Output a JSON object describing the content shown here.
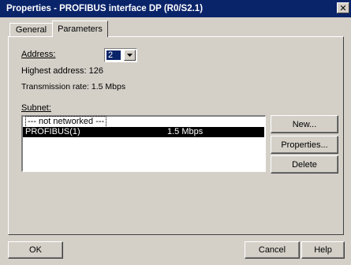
{
  "window": {
    "title": "Properties - PROFIBUS interface  DP (R0/S2.1)",
    "close_glyph": "✕"
  },
  "tabs": [
    {
      "label": "General"
    },
    {
      "label": "Parameters"
    }
  ],
  "params": {
    "address_label": "Address:",
    "address_value": "2",
    "highest_address": "Highest address: 126",
    "transmission_rate": "Transmission rate: 1.5 Mbps",
    "subnet_label": "Subnet:"
  },
  "subnet_list": [
    {
      "name": "--- not networked ---",
      "rate": ""
    },
    {
      "name": "PROFIBUS(1)",
      "rate": "1.5 Mbps"
    }
  ],
  "side_buttons": {
    "new": "New...",
    "properties": "Properties...",
    "delete": "Delete"
  },
  "footer": {
    "ok": "OK",
    "cancel": "Cancel",
    "help": "Help"
  },
  "colors": {
    "titlebar": "#0a246a",
    "face": "#d4d0c8",
    "selection": "#000000"
  }
}
